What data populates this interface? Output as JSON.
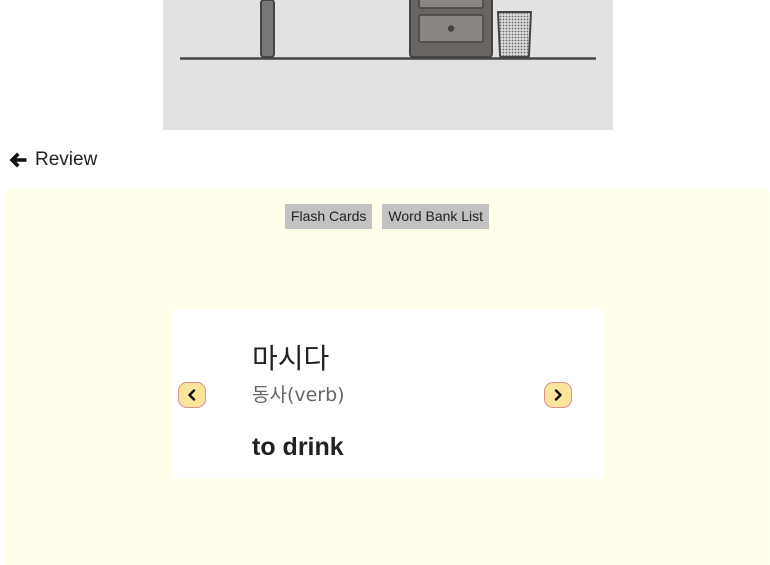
{
  "nav": {
    "back_label": "Review"
  },
  "tabs": [
    {
      "label": "Flash Cards"
    },
    {
      "label": "Word Bank List"
    }
  ],
  "card": {
    "word": "마시다",
    "part_of_speech": "동사(verb)",
    "meaning": "to drink"
  },
  "colors": {
    "panel_bg": "#fefeea",
    "tab_bg": "#c2c2c2",
    "nav_button_fill": "#fbe59a",
    "nav_button_border": "#e0908a",
    "illustration_bg": "#e2e2e2"
  },
  "icons": {
    "back": "arrow-left-icon",
    "prev": "chevron-left-icon",
    "next": "chevron-right-icon"
  }
}
